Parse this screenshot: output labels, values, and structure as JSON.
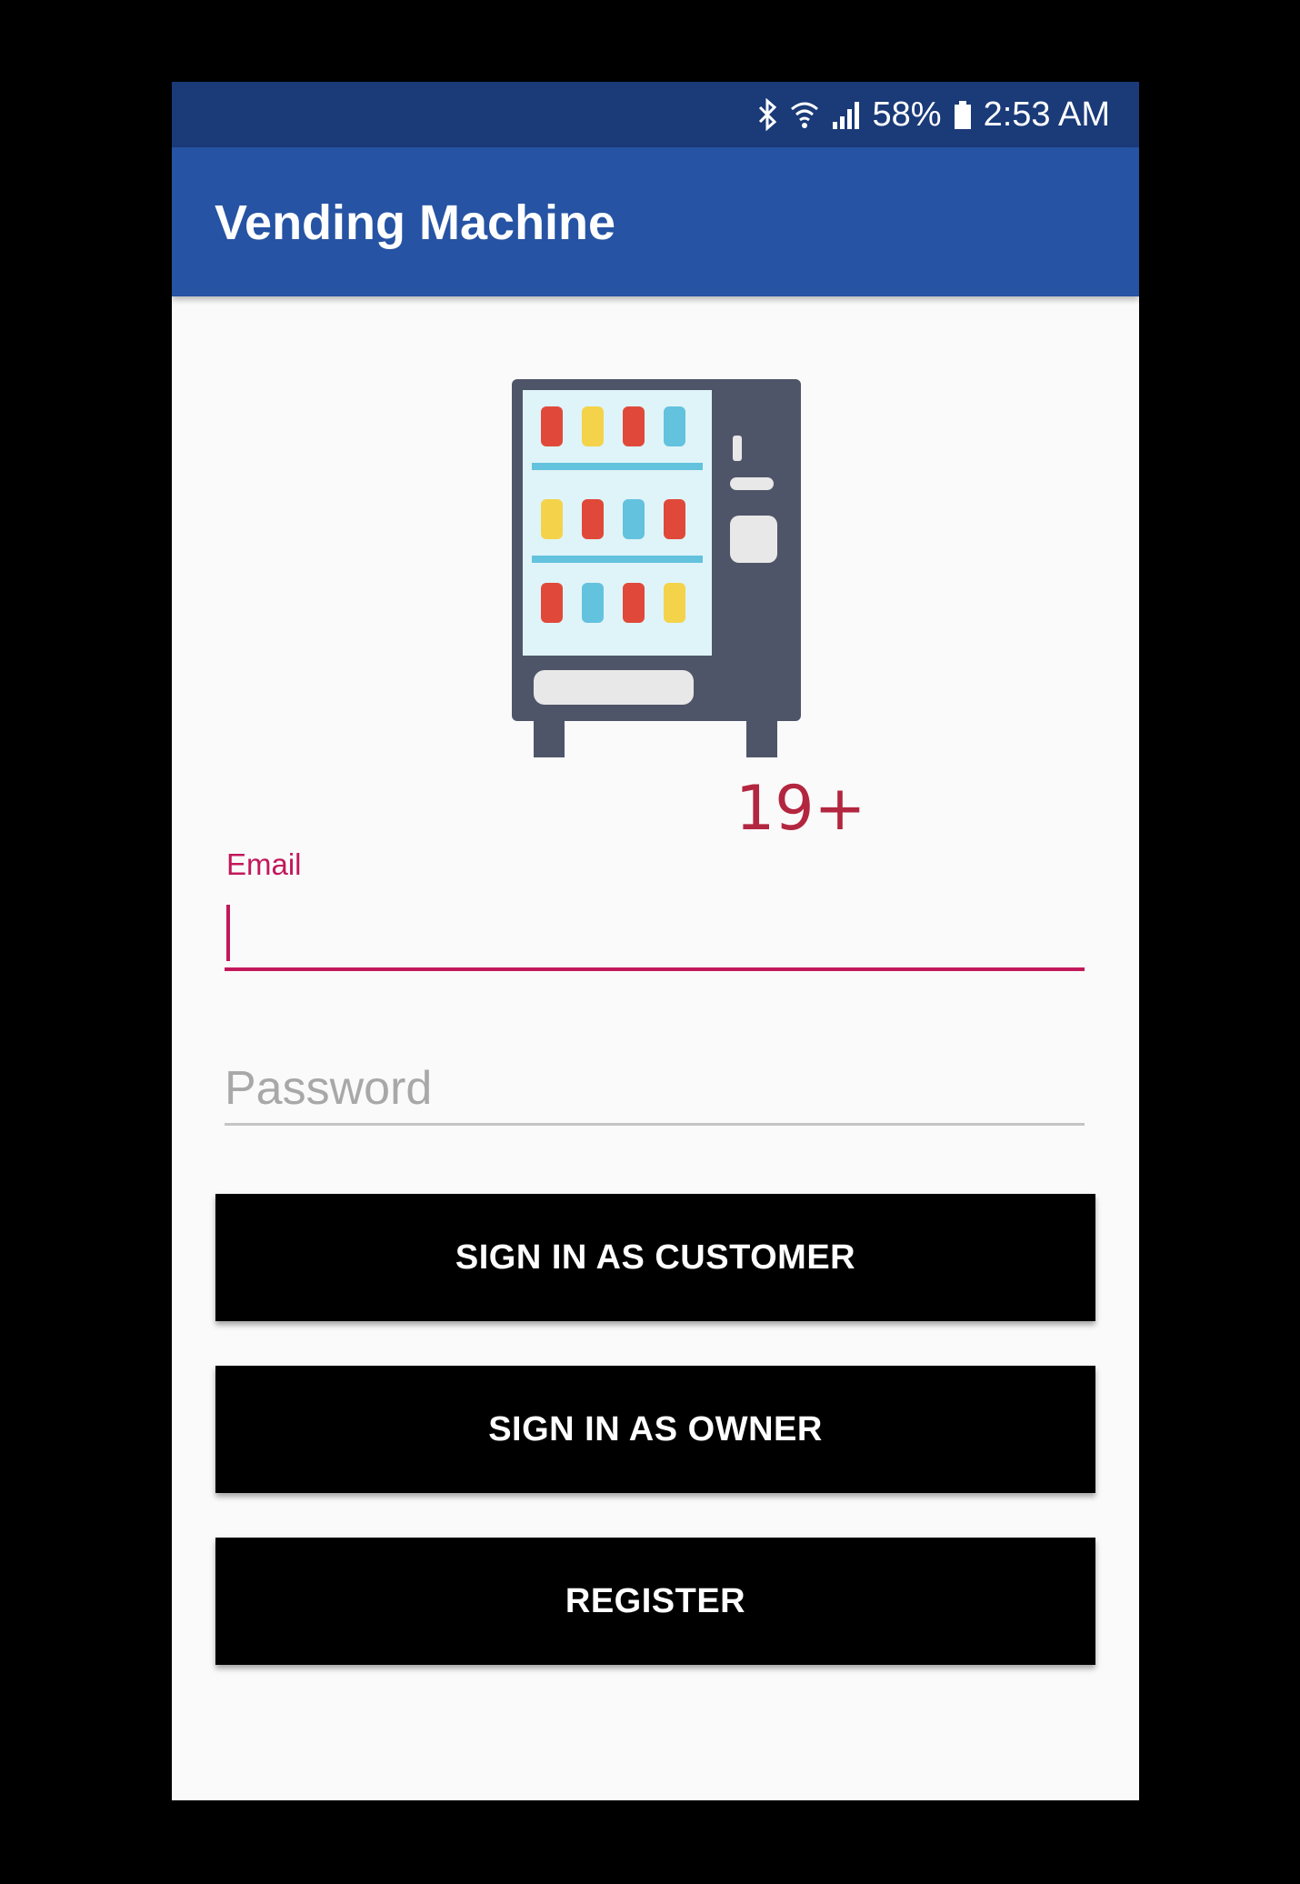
{
  "status_bar": {
    "battery": "58%",
    "time": "2:53 AM",
    "icons": [
      "bluetooth-icon",
      "wifi-icon",
      "signal-icon",
      "battery-icon"
    ]
  },
  "app_bar": {
    "title": "Vending Machine"
  },
  "logo": {
    "age_label": "19+"
  },
  "form": {
    "email_label": "Email",
    "email_value": "",
    "password_placeholder": "Password",
    "password_value": ""
  },
  "buttons": {
    "customer": "SIGN IN AS CUSTOMER",
    "owner": "SIGN IN AS OWNER",
    "register": "REGISTER"
  },
  "colors": {
    "status_bar": "#1a3a78",
    "app_bar": "#2653a3",
    "accent": "#c2185b",
    "age_label": "#b3263f",
    "button": "#000000"
  }
}
